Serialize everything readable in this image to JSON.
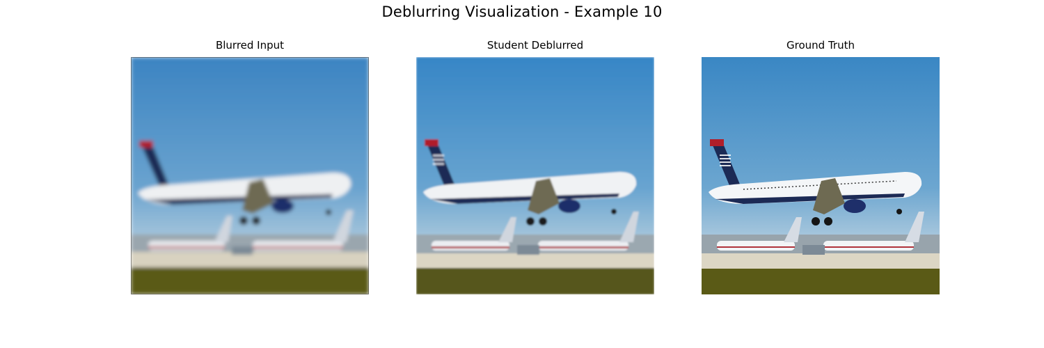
{
  "figure": {
    "title": "Deblurring Visualization - Example 10"
  },
  "panels": [
    {
      "title": "Blurred Input",
      "blur": 3,
      "icon": "airplane-photo"
    },
    {
      "title": "Student Deblurred",
      "blur": 1.2,
      "icon": "airplane-photo"
    },
    {
      "title": "Ground Truth",
      "blur": 0,
      "icon": "airplane-photo"
    }
  ],
  "colors": {
    "sky_top": "#3b86c4",
    "sky_bottom": "#9ec4dc",
    "grass": "#5a5a14",
    "runway": "#d8d2c0",
    "tail_navy": "#1c2a55",
    "tail_red": "#b01e2a",
    "fuselage": "#eef0f2"
  }
}
